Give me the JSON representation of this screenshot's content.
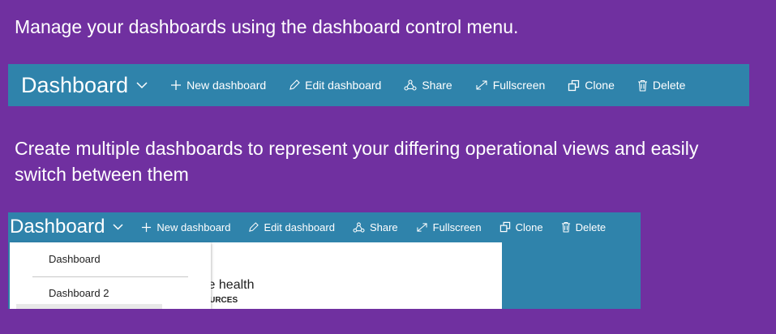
{
  "captions": {
    "first": "Manage your dashboards using the dashboard control menu.",
    "second": "Create multiple dashboards to represent your differing operational views and easily switch between them"
  },
  "toolbar": {
    "title": "Dashboard",
    "commands": [
      {
        "label": "New dashboard",
        "icon": "plus-icon"
      },
      {
        "label": "Edit dashboard",
        "icon": "pencil-icon"
      },
      {
        "label": "Share",
        "icon": "share-icon"
      },
      {
        "label": "Fullscreen",
        "icon": "fullscreen-icon"
      },
      {
        "label": "Clone",
        "icon": "clone-icon"
      },
      {
        "label": "Delete",
        "icon": "trash-icon"
      }
    ]
  },
  "dropdown": {
    "items": [
      "Dashboard",
      "Dashboard 2"
    ]
  },
  "card": {
    "title": "vice health",
    "subtitle": "ESOURCES"
  },
  "colors": {
    "background": "#7030a0",
    "toolbar": "#2f83ab",
    "text": "#ffffff"
  }
}
